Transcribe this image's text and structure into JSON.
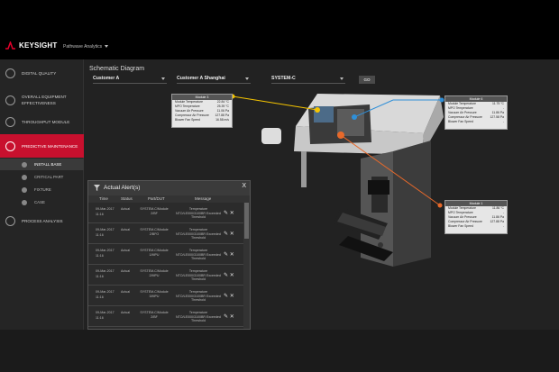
{
  "brand": {
    "name": "KEYSIGHT",
    "app": "Pathwave Analytics"
  },
  "colors": {
    "accent": "#c8102e",
    "line_yellow": "#f5c400",
    "line_blue": "#2f8fd8",
    "line_orange": "#e8692a"
  },
  "sidebar": {
    "items": [
      {
        "label": "DIGITAL QUALITY",
        "icon": "clipboard-icon"
      },
      {
        "label": "OVERALL EQUIPMENT EFFECTIVENESS",
        "icon": "gauge-icon"
      },
      {
        "label": "THROUGHPUT MODULE",
        "icon": "gear-icon"
      },
      {
        "label": "PREDICTIVE MAINTENANCE",
        "icon": "heartbeat-icon",
        "active": true
      },
      {
        "label": "PROCESS ANALYSIS",
        "icon": "chart-icon"
      }
    ],
    "subitems": [
      {
        "label": "INSTALL BASE",
        "active": true
      },
      {
        "label": "CRITICAL PART"
      },
      {
        "label": "FIXTURE"
      },
      {
        "label": "CASE"
      }
    ],
    "footer": {
      "user": "user-icon",
      "bell": "bell-icon",
      "collapse": "collapse-icon"
    }
  },
  "main": {
    "title": "Schematic Diagram",
    "filters": {
      "customer": "Customer A",
      "site": "Customer A Shanghai",
      "system": "SYSTEM-C",
      "go_label": "GO"
    }
  },
  "modules": [
    {
      "title": "Module 3",
      "rows": [
        [
          "Module Temperature",
          "22.84 °C"
        ],
        [
          "MPO Temperature",
          "25.39 °C"
        ],
        [
          "Vacuum Air Pressure",
          "11.06 Pa"
        ],
        [
          "Compressor Air Pressure",
          "127.88 Pa"
        ],
        [
          "Blower Fan Speed",
          "16.58 m/s"
        ]
      ]
    },
    {
      "title": "Module 6",
      "rows": [
        [
          "Module Temperature",
          "11.75 °C"
        ],
        [
          "MPO Temperature",
          "-"
        ],
        [
          "Vacuum Air Pressure",
          "11.86 Pa"
        ],
        [
          "Compressor Air Pressure",
          "127.58 Pa"
        ],
        [
          "Blower Fan Speed",
          "-"
        ]
      ]
    },
    {
      "title": "Module 1",
      "rows": [
        [
          "Module Temperature",
          "11.86 °C"
        ],
        [
          "MPO Temperature",
          "-"
        ],
        [
          "Vacuum Air Pressure",
          "11.86 Pa"
        ],
        [
          "Compressor Air Pressure",
          "127.88 Pa"
        ],
        [
          "Blower Fan Speed",
          "-"
        ]
      ]
    }
  ],
  "alerts": {
    "title": "Actual Alert(s)",
    "close": "X",
    "columns": [
      "Time",
      "Status",
      "Part/DUT",
      "Message"
    ],
    "rows": [
      {
        "date": "09-Mar-2017",
        "time": "11:16",
        "status": "Actual",
        "part": "SYSTEM-C/Module 2/BF",
        "message": "Temperature NTO/LE000/3100BR Exceeded Threshold"
      },
      {
        "date": "09-Mar-2017",
        "time": "11:16",
        "status": "Actual",
        "part": "SYSTEM-C/Module 2/BFO",
        "message": "Temperature NTO/LE000/3100BR Exceeded Threshold"
      },
      {
        "date": "09-Mar-2017",
        "time": "11:16",
        "status": "Actual",
        "part": "SYSTEM-C/Module 1/MPU",
        "message": "Temperature NTO/LE000/3100BR Exceeded Threshold"
      },
      {
        "date": "09-Mar-2017",
        "time": "11:16",
        "status": "Actual",
        "part": "SYSTEM-C/Module 2/MPU",
        "message": "Temperature NTO/LE000/3100BR Exceeded Threshold"
      },
      {
        "date": "09-Mar-2017",
        "time": "11:16",
        "status": "Actual",
        "part": "SYSTEM-C/Module 3/MPU",
        "message": "Temperature NTO/LE000/3100BR Exceeded Threshold"
      },
      {
        "date": "09-Mar-2017",
        "time": "11:16",
        "status": "Actual",
        "part": "SYSTEM-C/Module 2/BF",
        "message": "Temperature NTO/LE000/3100BR Exceeded Threshold"
      }
    ]
  }
}
